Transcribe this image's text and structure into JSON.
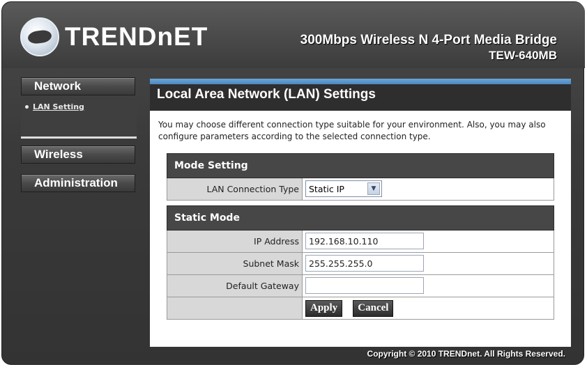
{
  "brand": {
    "logo_text": "TRENDnET"
  },
  "header": {
    "product_title": "300Mbps Wireless N 4-Port Media Bridge",
    "model": "TEW-640MB"
  },
  "sidebar": {
    "network_label": "Network",
    "lan_setting_label": "LAN Setting",
    "wireless_label": "Wireless",
    "administration_label": "Administration"
  },
  "page": {
    "title": "Local Area Network (LAN) Settings",
    "description": "You may choose different connection type suitable for your environment. Also, you may also configure parameters according to the selected connection type."
  },
  "mode_setting": {
    "header": "Mode Setting",
    "lan_connection_type_label": "LAN Connection Type",
    "lan_connection_type_value": "Static IP"
  },
  "static_mode": {
    "header": "Static Mode",
    "ip_address_label": "IP Address",
    "ip_address_value": "192.168.10.110",
    "subnet_mask_label": "Subnet Mask",
    "subnet_mask_value": "255.255.255.0",
    "default_gateway_label": "Default Gateway",
    "default_gateway_value": ""
  },
  "actions": {
    "apply_label": "Apply",
    "cancel_label": "Cancel"
  },
  "footer": {
    "copyright": "Copyright © 2010 TRENDnet. All Rights Reserved."
  }
}
